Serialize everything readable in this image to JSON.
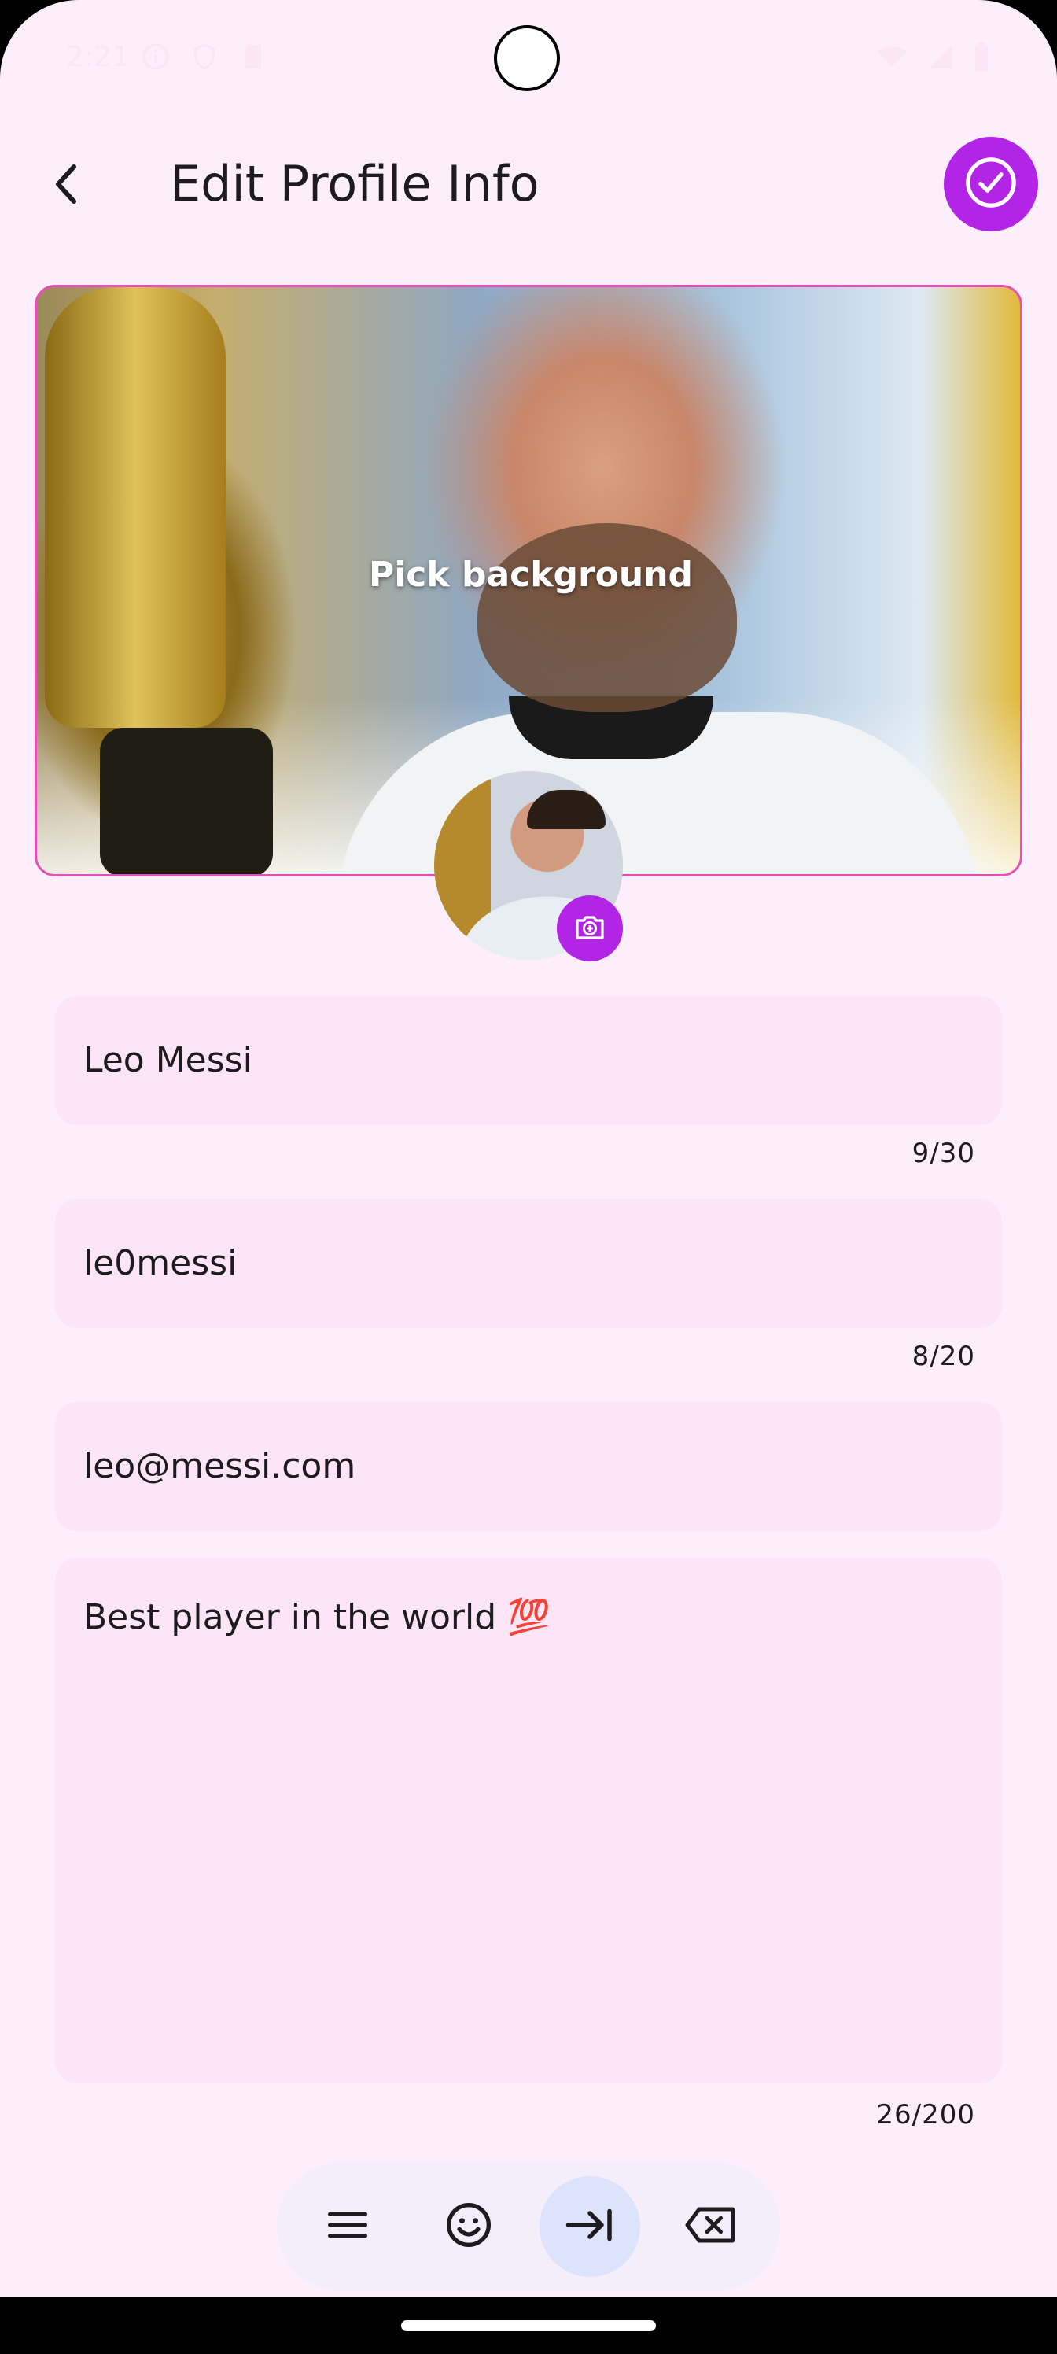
{
  "status_bar": {
    "time": "2:21",
    "left_icons": [
      "info-icon",
      "shield-icon",
      "sd-card-icon"
    ],
    "right_icons": [
      "wifi-icon",
      "signal-icon",
      "battery-icon"
    ]
  },
  "header": {
    "title": "Edit Profile Info",
    "back_icon": "chevron-left-icon",
    "save_icon": "check-circle-icon"
  },
  "background": {
    "label": "Pick background"
  },
  "avatar": {
    "edit_icon": "add-photo-icon"
  },
  "form": {
    "name": {
      "value": "Leo Messi",
      "counter": "9/30"
    },
    "username": {
      "value": "le0messi",
      "counter": "8/20"
    },
    "email": {
      "value": "leo@messi.com"
    },
    "bio": {
      "value": "Best player in the world 💯",
      "counter": "26/200"
    }
  },
  "keyboard_toolbar": {
    "buttons": [
      "menu-icon",
      "emoji-icon",
      "tab-next-icon",
      "backspace-icon"
    ],
    "active": "tab-next-icon"
  },
  "colors": {
    "accent": "#b325e6",
    "background": "#fdeefb",
    "field_bg": "#fbe5f6",
    "card_border": "#e64fb4",
    "toolbar_bg": "#f3eef9",
    "toolbar_active": "#dde3fb"
  }
}
